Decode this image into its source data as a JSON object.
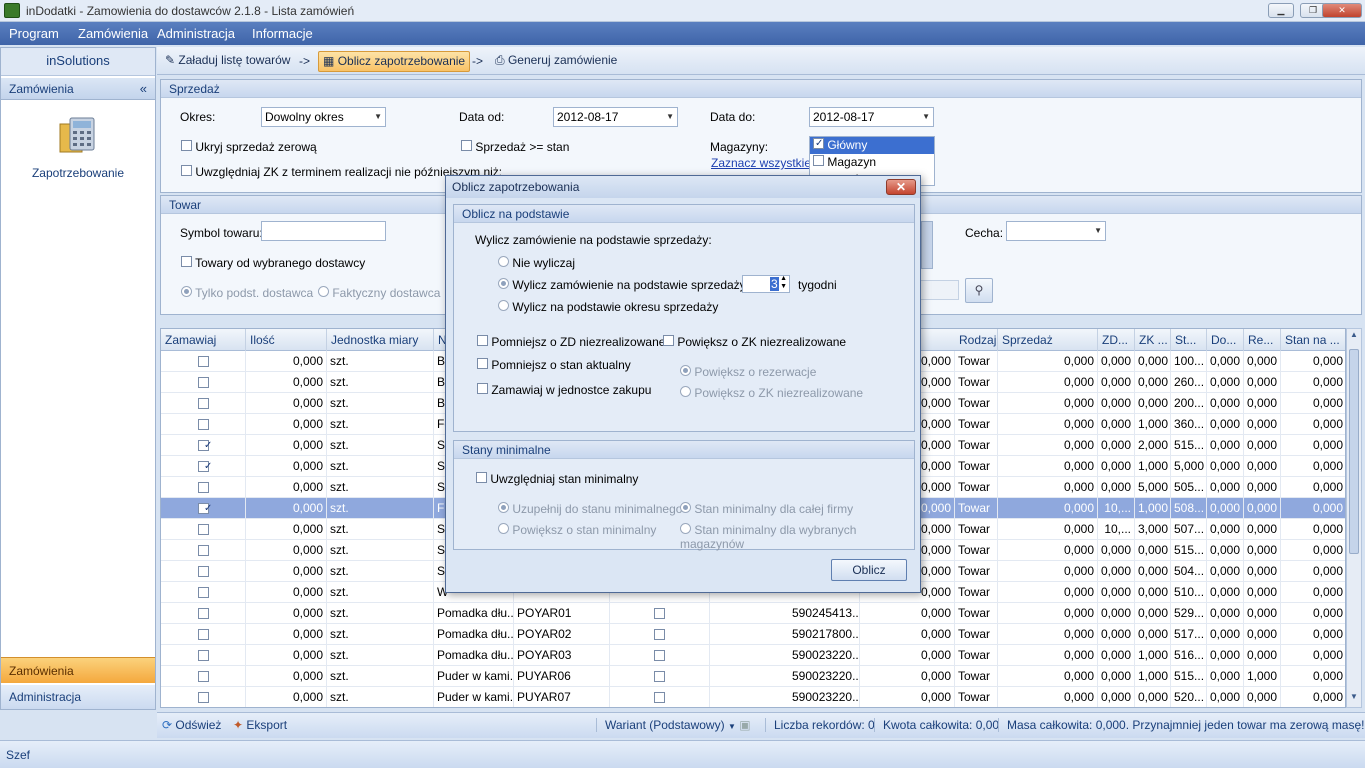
{
  "window": {
    "title": "inDodatki - Zamowienia do dostawców 2.1.8 - Lista zamówień",
    "min": "▁",
    "max": "❐",
    "close": "✕"
  },
  "menu": [
    "Program",
    "Zamówienia",
    "Administracja",
    "Informacje"
  ],
  "left": {
    "brand": "inSolutions",
    "section": "Zamówienia",
    "collapse": "«",
    "item": "Zapotrzebowanie",
    "nav": [
      "Zamówienia",
      "Administracja"
    ]
  },
  "toolbar": {
    "load": "Załaduj listę towarów",
    "arrow1": "->",
    "calc": "Oblicz zapotrzebowanie",
    "arrow2": "->",
    "gen": "Generuj zamówienie"
  },
  "sales": {
    "title": "Sprzedaż",
    "period_label": "Okres:",
    "period_value": "Dowolny okres",
    "date_from_label": "Data od:",
    "date_from": "2012-08-17",
    "date_to_label": "Data do:",
    "date_to": "2012-08-17",
    "hide_zero": "Ukryj sprzedaż zerową",
    "sales_ge_stock": "Sprzedaż >= stan",
    "include_zk": "Uwzględniaj ZK z terminem realizacji nie późniejszym niż:",
    "warehouses_label": "Magazyny:",
    "select_all": "Zaznacz wszystkie",
    "warehouses": [
      "Główny",
      "Magazyn pomocniczy"
    ]
  },
  "product": {
    "title": "Towar",
    "symbol_label": "Symbol towaru:",
    "feature_label": "Cecha:",
    "from_supplier": "Towary od wybranego dostawcy",
    "only_main": "Tylko podst. dostawca",
    "actual": "Faktyczny dostawca"
  },
  "grid": {
    "headers": [
      "Zamawiaj",
      "Ilość",
      "Jednostka miary",
      "N",
      "Rodzaj",
      "Sprzedaż",
      "ZD...",
      "ZK ...",
      "St...",
      "Do...",
      "Re...",
      "Stan na ..."
    ],
    "rows": [
      {
        "chk": false,
        "qty": "0,000",
        "unit": "szt.",
        "name": "Ba",
        "sym": "",
        "ean": "",
        "v": "0,000",
        "kind": "Towar",
        "sale": "0,000",
        "zd": "0,000",
        "zk": "0,000",
        "st": "100...",
        "do": "0,000",
        "re": "0,000",
        "stan": "0,000"
      },
      {
        "chk": false,
        "qty": "0,000",
        "unit": "szt.",
        "name": "Ba",
        "sym": "",
        "ean": "",
        "v": "0,000",
        "kind": "Towar",
        "sale": "0,000",
        "zd": "0,000",
        "zk": "0,000",
        "st": "260...",
        "do": "0,000",
        "re": "0,000",
        "stan": "0,000"
      },
      {
        "chk": false,
        "qty": "0,000",
        "unit": "szt.",
        "name": "Ba",
        "sym": "",
        "ean": "",
        "v": "0,000",
        "kind": "Towar",
        "sale": "0,000",
        "zd": "0,000",
        "zk": "0,000",
        "st": "200...",
        "do": "0,000",
        "re": "0,000",
        "stan": "0,000"
      },
      {
        "chk": false,
        "qty": "0,000",
        "unit": "szt.",
        "name": "Fo",
        "sym": "",
        "ean": "",
        "v": "0,000",
        "kind": "Towar",
        "sale": "0,000",
        "zd": "0,000",
        "zk": "1,000",
        "st": "360...",
        "do": "0,000",
        "re": "0,000",
        "stan": "0,000"
      },
      {
        "chk": true,
        "qty": "0,000",
        "unit": "szt.",
        "name": "Sc",
        "sym": "",
        "ean": "",
        "v": "0,000",
        "kind": "Towar",
        "sale": "0,000",
        "zd": "0,000",
        "zk": "2,000",
        "st": "515...",
        "do": "0,000",
        "re": "0,000",
        "stan": "0,000"
      },
      {
        "chk": true,
        "qty": "0,000",
        "unit": "szt.",
        "name": "Sc",
        "sym": "",
        "ean": "",
        "v": "0,000",
        "kind": "Towar",
        "sale": "0,000",
        "zd": "0,000",
        "zk": "1,000",
        "st": "5,000",
        "do": "0,000",
        "re": "0,000",
        "stan": "0,000"
      },
      {
        "chk": false,
        "qty": "0,000",
        "unit": "szt.",
        "name": "Sc",
        "sym": "",
        "ean": "",
        "v": "0,000",
        "kind": "Towar",
        "sale": "0,000",
        "zd": "0,000",
        "zk": "5,000",
        "st": "505...",
        "do": "0,000",
        "re": "0,000",
        "stan": "0,000"
      },
      {
        "chk": true,
        "qty": "0,000",
        "unit": "szt.",
        "name": "Fl",
        "sym": "",
        "ean": "",
        "v": "0,000",
        "kind": "Towar",
        "sale": "0,000",
        "zd": "10,...",
        "zk": "1,000",
        "st": "508...",
        "do": "0,000",
        "re": "0,000",
        "stan": "0,000",
        "sel": true
      },
      {
        "chk": false,
        "qty": "0,000",
        "unit": "szt.",
        "name": "Sc",
        "sym": "",
        "ean": "",
        "v": "0,000",
        "kind": "Towar",
        "sale": "0,000",
        "zd": "10,...",
        "zk": "3,000",
        "st": "507...",
        "do": "0,000",
        "re": "0,000",
        "stan": "0,000"
      },
      {
        "chk": false,
        "qty": "0,000",
        "unit": "szt.",
        "name": "Sc",
        "sym": "",
        "ean": "",
        "v": "0,000",
        "kind": "Towar",
        "sale": "0,000",
        "zd": "0,000",
        "zk": "0,000",
        "st": "515...",
        "do": "0,000",
        "re": "0,000",
        "stan": "0,000"
      },
      {
        "chk": false,
        "qty": "0,000",
        "unit": "szt.",
        "name": "Sc",
        "sym": "",
        "ean": "",
        "v": "0,000",
        "kind": "Towar",
        "sale": "0,000",
        "zd": "0,000",
        "zk": "0,000",
        "st": "504...",
        "do": "0,000",
        "re": "0,000",
        "stan": "0,000"
      },
      {
        "chk": false,
        "qty": "0,000",
        "unit": "szt.",
        "name": "W",
        "sym": "",
        "ean": "",
        "v": "0,000",
        "kind": "Towar",
        "sale": "0,000",
        "zd": "0,000",
        "zk": "0,000",
        "st": "510...",
        "do": "0,000",
        "re": "0,000",
        "stan": "0,000"
      },
      {
        "chk": false,
        "qty": "0,000",
        "unit": "szt.",
        "name": "Pomadka dłu...",
        "sym": "POYAR01",
        "ean": "590245413...",
        "v": "0,000",
        "kind": "Towar",
        "sale": "0,000",
        "zd": "0,000",
        "zk": "0,000",
        "st": "529...",
        "do": "0,000",
        "re": "0,000",
        "stan": "0,000"
      },
      {
        "chk": false,
        "qty": "0,000",
        "unit": "szt.",
        "name": "Pomadka dłu...",
        "sym": "POYAR02",
        "ean": "590217800...",
        "v": "0,000",
        "kind": "Towar",
        "sale": "0,000",
        "zd": "0,000",
        "zk": "0,000",
        "st": "517...",
        "do": "0,000",
        "re": "0,000",
        "stan": "0,000"
      },
      {
        "chk": false,
        "qty": "0,000",
        "unit": "szt.",
        "name": "Pomadka dłu...",
        "sym": "POYAR03",
        "ean": "590023220...",
        "v": "0,000",
        "kind": "Towar",
        "sale": "0,000",
        "zd": "0,000",
        "zk": "1,000",
        "st": "516...",
        "do": "0,000",
        "re": "0,000",
        "stan": "0,000"
      },
      {
        "chk": false,
        "qty": "0,000",
        "unit": "szt.",
        "name": "Puder w kami...",
        "sym": "PUYAR06",
        "ean": "590023220...",
        "v": "0,000",
        "kind": "Towar",
        "sale": "0,000",
        "zd": "0,000",
        "zk": "1,000",
        "st": "515...",
        "do": "0,000",
        "re": "1,000",
        "stan": "0,000"
      },
      {
        "chk": false,
        "qty": "0,000",
        "unit": "szt.",
        "name": "Puder w kami...",
        "sym": "PUYAR07",
        "ean": "590023220...",
        "v": "0,000",
        "kind": "Towar",
        "sale": "0,000",
        "zd": "0,000",
        "zk": "0,000",
        "st": "520...",
        "do": "0,000",
        "re": "0,000",
        "stan": "0,000"
      }
    ]
  },
  "status": {
    "refresh": "Odśwież",
    "export": "Eksport",
    "variant": "Wariant (Podstawowy)",
    "records": "Liczba rekordów: 0",
    "amount": "Kwota całkowita: 0,00",
    "mass": "Masa całkowita: 0,000. Przynajmniej jeden towar ma zerową masę!",
    "user": "Szef"
  },
  "dialog": {
    "title": "Oblicz zapotrzebowania",
    "close": "✕",
    "basis_title": "Oblicz na podstawie",
    "basis_label": "Wylicz zamówienie na podstawie sprzedaży:",
    "opt_none": "Nie wyliczaj",
    "opt_weeks": "Wylicz zamówienie na podstawie sprzedaży na",
    "weeks_value": "3",
    "weeks_unit": "tygodni",
    "opt_period": "Wylicz na podstawie okresu sprzedaży",
    "reduce_zd": "Pomniejsz o ZD niezrealizowane",
    "increase_zk": "Powiększ o ZK niezrealizowane",
    "reduce_stock": "Pomniejsz o stan aktualny",
    "inc_reservation": "Powiększ o rezerwacje",
    "inc_zk2": "Powiększ o ZK niezrealizowane",
    "order_unit": "Zamawiaj w jednostce zakupu",
    "min_title": "Stany minimalne",
    "min_check": "Uwzględniaj stan minimalny",
    "min_fill": "Uzupełnij do stanu minimalnego",
    "min_inc": "Powiększ o stan minimalny",
    "min_company": "Stan minimalny dla całej firmy",
    "min_selected": "Stan minimalny dla wybranych magazynów",
    "calc_button": "Oblicz"
  }
}
